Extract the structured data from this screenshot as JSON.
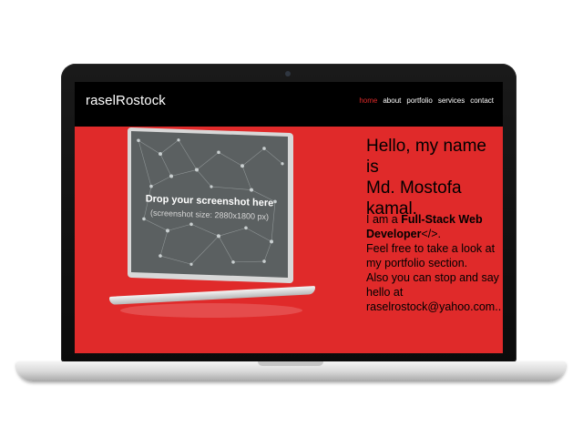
{
  "header": {
    "logo": "raselRostock",
    "nav": [
      {
        "label": "home",
        "active": true
      },
      {
        "label": "about",
        "active": false
      },
      {
        "label": "portfolio",
        "active": false
      },
      {
        "label": "services",
        "active": false
      },
      {
        "label": "contact",
        "active": false
      }
    ]
  },
  "hero": {
    "greeting_line1": "Hello, my name is",
    "greeting_line2": "Md. Mostofa kamal.",
    "bio_intro": "I am a ",
    "bio_role": "Full-Stack Web Developer",
    "bio_code_symbol": "</>",
    "bio_period": ".",
    "bio_line2": "Feel free to take a look at my portfolio section.",
    "bio_line3": "Also you can stop and say hello at raselrostock@yahoo.com.."
  },
  "mockup": {
    "title": "Drop your screenshot here",
    "subtitle": "(screenshot size: 2880x1800 px)"
  },
  "colors": {
    "accent": "#e02a2a",
    "header_bg": "#000000",
    "text_light": "#ffffff"
  }
}
